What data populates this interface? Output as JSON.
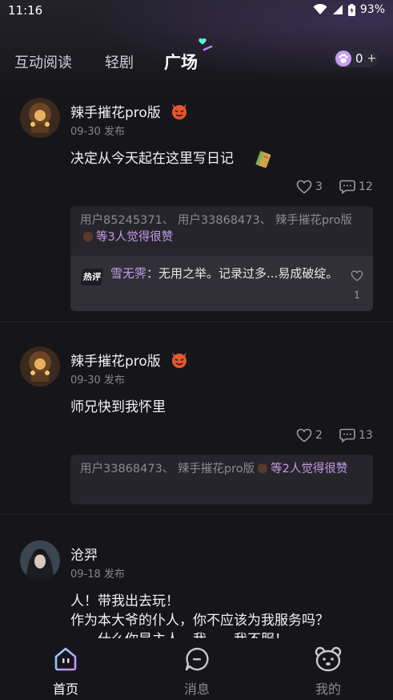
{
  "status_bar": {
    "time": "11:16",
    "battery": "93%"
  },
  "tabs": [
    {
      "label": "互动阅读",
      "active": false
    },
    {
      "label": "轻剧",
      "active": false
    },
    {
      "label": "广场",
      "active": true
    }
  ],
  "paw_badge": {
    "count": "0",
    "plus": "+"
  },
  "posts": [
    {
      "author": "辣手摧花pro版",
      "date": "09-30 发布",
      "content": "决定从今天起在这里写日记",
      "likes": "3",
      "comments": "12",
      "likers_text": "用户85245371、 用户33868473、 辣手摧花pro版",
      "likers_summary": "等3人觉得很赞",
      "top_comment": {
        "tag": "热评",
        "user": "雪无霁",
        "text": "：无用之举。记录过多...易成破绽。",
        "likes": "1"
      }
    },
    {
      "author": "辣手摧花pro版",
      "date": "09-30 发布",
      "content": "师兄快到我怀里",
      "likes": "2",
      "comments": "13",
      "likers_text": "用户33868473、 辣手摧花pro版",
      "likers_summary": "等2人觉得很赞"
    },
    {
      "author": "沧羿",
      "date": "09-18 发布",
      "content_lines": [
        "人！带我出去玩！",
        "作为本大爷的仆人，你不应该为我服务吗？",
        "……什么你是主人，我……我不服！"
      ]
    }
  ],
  "bottom_nav": [
    {
      "label": "首页",
      "icon": "home-icon",
      "active": true
    },
    {
      "label": "消息",
      "icon": "message-icon",
      "active": false
    },
    {
      "label": "我的",
      "icon": "profile-icon",
      "active": false
    }
  ],
  "colors": {
    "accent": "#c79be8",
    "background": "#16161a",
    "card": "#26252c"
  }
}
